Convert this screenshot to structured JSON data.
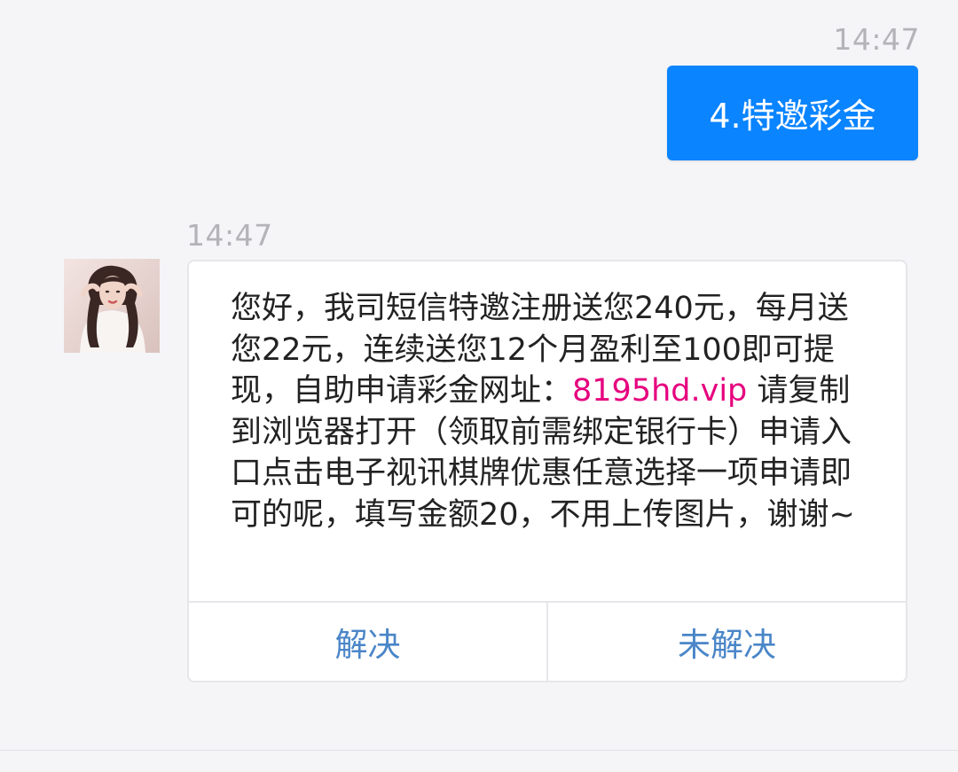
{
  "conversation": {
    "sent_message": {
      "timestamp": "14:47",
      "text": "4.特邀彩金"
    },
    "received_message": {
      "timestamp": "14:47",
      "avatar_icon": "woman-portrait-avatar",
      "text_before_link": "您好，我司短信特邀注册送您240元，每月送您22元，连续送您12个月盈利至100即可提现，自助申请彩金网址：",
      "link_text": "8195hd.vip",
      "text_after_link": " 请复制到浏览器打开（领取前需绑定银行卡）申请入口点击电子视讯棋牌优惠任意选择一项申请即可的呢，填写金额20，不用上传图片，谢谢~",
      "actions": {
        "resolved_label": "解决",
        "unresolved_label": "未解决"
      }
    }
  },
  "colors": {
    "sent_bubble": "#0a84ff",
    "link": "#e6007e",
    "action_text": "#4a86c8",
    "timestamp": "#b3b3b8",
    "background": "#f5f5f8"
  }
}
